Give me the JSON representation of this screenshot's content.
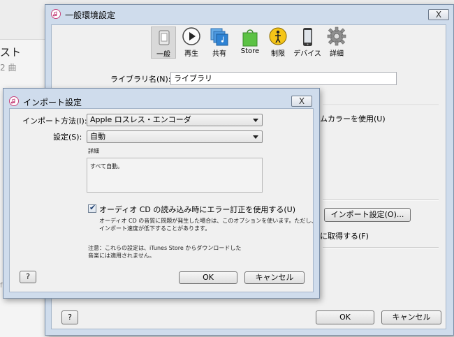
{
  "background_app": {
    "title_fragment": "スト",
    "count_fragment": "2 曲",
    "tick_fragment": "f"
  },
  "general_window": {
    "title": "一般環境設定",
    "close_label": "X",
    "toolbar": [
      {
        "label": "一般",
        "icon": "general-icon",
        "selected": true
      },
      {
        "label": "再生",
        "icon": "play-icon",
        "selected": false
      },
      {
        "label": "共有",
        "icon": "share-icon",
        "selected": false
      },
      {
        "label": "Store",
        "icon": "store-bag-icon",
        "selected": false
      },
      {
        "label": "制限",
        "icon": "parental-icon",
        "selected": false
      },
      {
        "label": "デバイス",
        "icon": "device-icon",
        "selected": false
      },
      {
        "label": "詳細",
        "icon": "gear-icon",
        "selected": false
      }
    ],
    "library_name_label": "ライブラリ名(N):",
    "library_name_value": "ライブラリ",
    "partial_color_option": "ムカラーを使用(U)",
    "import_settings_button": "インポート設定(O)...",
    "partial_fetch_option": "に取得する(F)",
    "help_button": "?",
    "ok_button": "OK",
    "cancel_button": "キャンセル"
  },
  "import_dialog": {
    "title": "インポート設定",
    "close_label": "X",
    "import_method_label": "インポート方法(I):",
    "import_method_value": "Apple ロスレス・エンコーダ",
    "setting_label": "設定(S):",
    "setting_value": "自動",
    "details_label": "詳細",
    "details_text": "すべて自動。",
    "error_correction_checked": true,
    "error_correction_label": "オーディオ CD の読み込み時にエラー訂正を使用する(U)",
    "error_correction_desc_1": "オーディオ CD の音質に問題が発生した場合は、このオプションを使います。ただし、",
    "error_correction_desc_2": "インポート速度が低下することがあります。",
    "note_1": "注意：これらの設定は、iTunes Store からダウンロードした",
    "note_2": "音楽には適用されません。",
    "help_button": "?",
    "ok_button": "OK",
    "cancel_button": "キャンセル"
  }
}
